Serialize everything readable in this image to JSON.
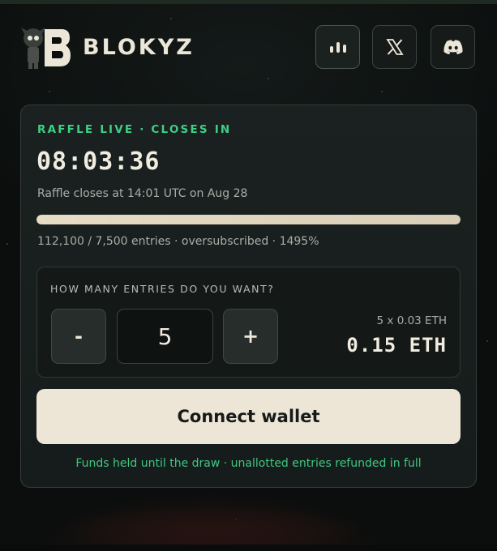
{
  "header": {
    "brand": "BLOKYZ",
    "logo_icon": "blokyz-logo-icon",
    "buttons": [
      {
        "name": "stats",
        "icon": "bar-chart-icon"
      },
      {
        "name": "x",
        "icon": "x-logo-icon"
      },
      {
        "name": "discord",
        "icon": "discord-icon"
      }
    ]
  },
  "raffle": {
    "status": "RAFFLE LIVE · CLOSES IN",
    "countdown": "08:03:36",
    "closes_at": "Raffle closes at 14:01 UTC on Aug 28",
    "progress_fraction": 1.0,
    "entries_summary": "112,100 / 7,500 entries · oversubscribed · 1495%"
  },
  "quantity": {
    "label": "HOW MANY ENTRIES DO YOU WANT?",
    "minus_label": "-",
    "plus_label": "+",
    "value": "5",
    "calc": "5 x 0.03 ETH",
    "total": "0.15 ETH"
  },
  "actions": {
    "connect_label": "Connect wallet",
    "note": "Funds held until the draw · unallotted entries refunded in full"
  },
  "colors": {
    "accent_green": "#3ecf82",
    "cream": "#ede5d6",
    "card_bg": "#1a2120"
  }
}
